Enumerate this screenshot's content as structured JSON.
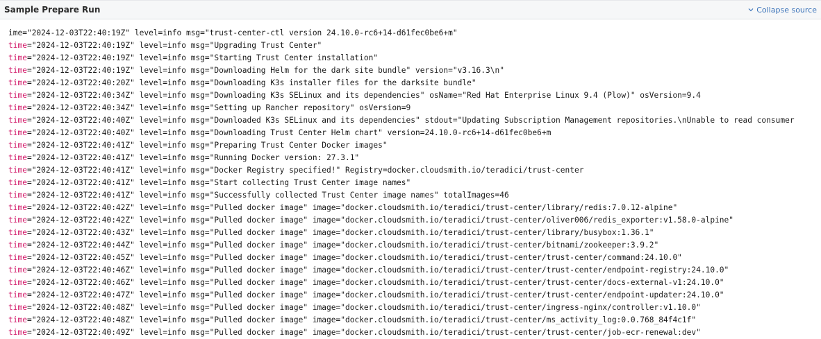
{
  "header": {
    "title": "Sample Prepare Run",
    "collapse_label": "Collapse source",
    "collapse_icon": "chevron-down-icon",
    "link_color": "#3b73b9"
  },
  "log": {
    "time_key_color": "#d21b6a",
    "lines": [
      {
        "key": "ime",
        "rest": "=\"2024-12-03T22:40:19Z\" level=info msg=\"trust-center-ctl version 24.10.0-rc6+14-d61fec0be6+m\""
      },
      {
        "key": "time",
        "rest": "=\"2024-12-03T22:40:19Z\" level=info msg=\"Upgrading Trust Center\""
      },
      {
        "key": "time",
        "rest": "=\"2024-12-03T22:40:19Z\" level=info msg=\"Starting Trust Center installation\""
      },
      {
        "key": "time",
        "rest": "=\"2024-12-03T22:40:19Z\" level=info msg=\"Downloading Helm for the dark site bundle\" version=\"v3.16.3\\n\""
      },
      {
        "key": "time",
        "rest": "=\"2024-12-03T22:40:20Z\" level=info msg=\"Downloading K3s installer files for the darksite bundle\""
      },
      {
        "key": "time",
        "rest": "=\"2024-12-03T22:40:34Z\" level=info msg=\"Downloading K3s SELinux and its dependencies\" osName=\"Red Hat Enterprise Linux 9.4 (Plow)\" osVersion=9.4"
      },
      {
        "key": "time",
        "rest": "=\"2024-12-03T22:40:34Z\" level=info msg=\"Setting up Rancher repository\" osVersion=9"
      },
      {
        "key": "time",
        "rest": "=\"2024-12-03T22:40:40Z\" level=info msg=\"Downloaded K3s SELinux and its dependencies\" stdout=\"Updating Subscription Management repositories.\\nUnable to read consumer"
      },
      {
        "key": "time",
        "rest": "=\"2024-12-03T22:40:40Z\" level=info msg=\"Downloading Trust Center Helm chart\" version=24.10.0-rc6+14-d61fec0be6+m"
      },
      {
        "key": "time",
        "rest": "=\"2024-12-03T22:40:41Z\" level=info msg=\"Preparing Trust Center Docker images\""
      },
      {
        "key": "time",
        "rest": "=\"2024-12-03T22:40:41Z\" level=info msg=\"Running Docker version: 27.3.1\""
      },
      {
        "key": "time",
        "rest": "=\"2024-12-03T22:40:41Z\" level=info msg=\"Docker Registry specified!\" Registry=docker.cloudsmith.io/teradici/trust-center"
      },
      {
        "key": "time",
        "rest": "=\"2024-12-03T22:40:41Z\" level=info msg=\"Start collecting Trust Center image names\""
      },
      {
        "key": "time",
        "rest": "=\"2024-12-03T22:40:41Z\" level=info msg=\"Successfully collected Trust Center image names\" totalImages=46"
      },
      {
        "key": "time",
        "rest": "=\"2024-12-03T22:40:42Z\" level=info msg=\"Pulled docker image\" image=\"docker.cloudsmith.io/teradici/trust-center/library/redis:7.0.12-alpine\""
      },
      {
        "key": "time",
        "rest": "=\"2024-12-03T22:40:42Z\" level=info msg=\"Pulled docker image\" image=\"docker.cloudsmith.io/teradici/trust-center/oliver006/redis_exporter:v1.58.0-alpine\""
      },
      {
        "key": "time",
        "rest": "=\"2024-12-03T22:40:43Z\" level=info msg=\"Pulled docker image\" image=\"docker.cloudsmith.io/teradici/trust-center/library/busybox:1.36.1\""
      },
      {
        "key": "time",
        "rest": "=\"2024-12-03T22:40:44Z\" level=info msg=\"Pulled docker image\" image=\"docker.cloudsmith.io/teradici/trust-center/bitnami/zookeeper:3.9.2\""
      },
      {
        "key": "time",
        "rest": "=\"2024-12-03T22:40:45Z\" level=info msg=\"Pulled docker image\" image=\"docker.cloudsmith.io/teradici/trust-center/trust-center/command:24.10.0\""
      },
      {
        "key": "time",
        "rest": "=\"2024-12-03T22:40:46Z\" level=info msg=\"Pulled docker image\" image=\"docker.cloudsmith.io/teradici/trust-center/trust-center/endpoint-registry:24.10.0\""
      },
      {
        "key": "time",
        "rest": "=\"2024-12-03T22:40:46Z\" level=info msg=\"Pulled docker image\" image=\"docker.cloudsmith.io/teradici/trust-center/trust-center/docs-external-v1:24.10.0\""
      },
      {
        "key": "time",
        "rest": "=\"2024-12-03T22:40:47Z\" level=info msg=\"Pulled docker image\" image=\"docker.cloudsmith.io/teradici/trust-center/trust-center/endpoint-updater:24.10.0\""
      },
      {
        "key": "time",
        "rest": "=\"2024-12-03T22:40:48Z\" level=info msg=\"Pulled docker image\" image=\"docker.cloudsmith.io/teradici/trust-center/ingress-nginx/controller:v1.10.0\""
      },
      {
        "key": "time",
        "rest": "=\"2024-12-03T22:40:48Z\" level=info msg=\"Pulled docker image\" image=\"docker.cloudsmith.io/teradici/trust-center/ms_activity_log:0.0.768_84f4c1f\""
      },
      {
        "key": "time",
        "rest": "=\"2024-12-03T22:40:49Z\" level=info msg=\"Pulled docker image\" image=\"docker.cloudsmith.io/teradici/trust-center/trust-center/job-ecr-renewal:dev\""
      }
    ]
  }
}
